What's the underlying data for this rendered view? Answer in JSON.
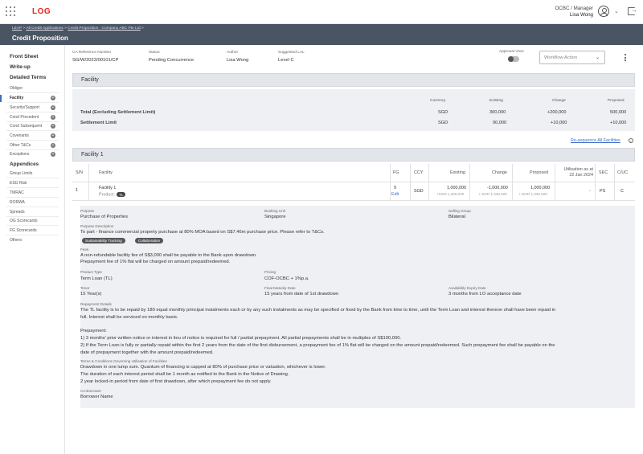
{
  "app": {
    "logo": "LOG",
    "user_role": "OCBC / Manager",
    "user_name": "Lisa Wong"
  },
  "breadcrumb": {
    "item1": "LEAP",
    "sep1": " > ",
    "item2": "All Credit Applications",
    "sep2": " > ",
    "item3": "Credit Proposition - Company ABC Pte Ltd",
    "sep3": " >"
  },
  "page_title": "Credit Proposition",
  "sidebar": {
    "front_sheet": "Front Sheet",
    "write_up": "Write-up",
    "detailed_terms": "Detailed Terms",
    "terms": [
      "Obligor",
      "Facility",
      "Security/Support",
      "Cond Precedent",
      "Cond Subsequent",
      "Covenants",
      "Other T&Cs",
      "Exceptions"
    ],
    "appendices": "Appendices",
    "appendix_items": [
      "Group Limits",
      "ESG Risk",
      "TMRAC",
      "RORWA",
      "Spreads",
      "OG Scorecards",
      "FG Scorecards",
      "Others"
    ]
  },
  "meta": {
    "ca_ref_label": "CA Reference Number",
    "ca_ref_value": "SG/W/2023/00101/CP",
    "status_label": "Status",
    "status_value": "Pending Concurrence",
    "author_label": "Author",
    "author_value": "Lisa Wong",
    "lal_label": "Suggested LAL",
    "lal_value": "Level C",
    "approval_view_label": "Approval View",
    "workflow_placeholder": "Workflow Action"
  },
  "facility_summary": {
    "section_title": "Facility",
    "headers": {
      "currency": "Currency",
      "existing": "Existing",
      "change": "Change",
      "proposed": "Proposed"
    },
    "rows": [
      {
        "label": "Total (Excluding Settlement Limit)",
        "currency": "SGD",
        "existing": "300,000",
        "change": "+200,000",
        "proposed": "500,000"
      },
      {
        "label": "Settlement Limit",
        "currency": "SGD",
        "existing": "90,000",
        "change": "+10,000",
        "proposed": "+10,000"
      }
    ]
  },
  "resequence_link": "Re-sequence All Facilities",
  "facility1": {
    "section_title": "Facility 1",
    "headers": {
      "sn": "S/N",
      "facility": "Facility",
      "fg": "FG",
      "ccy": "CCY",
      "existing": "Existing",
      "change": "Change",
      "proposed": "Proposed",
      "util_line1": "Utilisation as at",
      "util_line2": "22 Jan 2024",
      "sec": "SEC",
      "cuc": "C/UC"
    },
    "row": {
      "sn": "1",
      "facility_name": "Facility 1",
      "product_label": "Product:",
      "product_badge": "TL",
      "fg": "9",
      "edit": "Edit",
      "ccy": "SGD",
      "existing": "1,000,000",
      "existing_sub": "+SGD 1,330,020",
      "change": "-1,000,000",
      "change_sub": "+-SGD 1,330,020",
      "proposed": "1,000,000",
      "proposed_sub": "+-SGD 1,330,020",
      "utilisation": "-",
      "sec": "PS",
      "cuc": "C"
    }
  },
  "details": {
    "purpose_label": "Purpose",
    "purpose_value": "Purchase of Properties",
    "booking_unit_label": "Booking Unit",
    "booking_unit_value": "Singapore",
    "selling_group_label": "Selling Group",
    "selling_group_value": "Bilateral",
    "purpose_desc_label": "Purpose Description",
    "purpose_desc_value": "To part - finance commercial property purchase at 80% MOA based on S$7.46m purchase price. Please refer to T&Cs.",
    "tags": [
      "Sustainability Tracking",
      "Collaboration"
    ],
    "fees_label": "Fees",
    "fees_line1": "A non-refundable facility fee of S$3,000 shall be payable to the Bank upon drawdown.",
    "fees_line2": "Prepayment fee of 1% flat will be charged on amount prepaid/redeemed.",
    "product_type_label": "Product Type",
    "product_type_value": "Term Loan (TL)",
    "pricing_label": "Pricing",
    "pricing_value": "COF-OCBC + 1%p.a.",
    "tenor_label": "Tenor",
    "tenor_value": "15 Year(s)",
    "final_maturity_label": "Final Maturity Date",
    "final_maturity_value": "15 years from date of 1st drawdown",
    "availability_label": "Availability Expiry Date",
    "availability_value": "3 months from LO acceptance date",
    "repayment_label": "Repayment Details",
    "repayment_line1": "The TL facility is to be repaid by 180 equal monthly principal instalments each or by any such instalments as may be specified or fixed by the Bank from time to time, until the Term Loan and interest thereon shall have been repaid in",
    "repayment_line2": "full. Interest shall be serviced on monthly basis.",
    "prepayment_title": "Prepayment:",
    "prepayment_line1": "1) 3 months' prior written notice or interest in lieu of notice is required for full / partial prepayment. All partial prepayments shall be in multiples of S$100,000.",
    "prepayment_line2": "2) If the Term Loan is fully or partially repaid within the first 2 years from the date of the first disbursement, a prepayment fee of 1% flat will be charged on the amount prepaid/redeemed. Such prepayment fee shall be payable on the",
    "prepayment_line3": "date of prepayment together with the amount prepaid/redeemed.",
    "tnc_label": "Terms & Conditions Governing Utilisation of Facilities",
    "tnc_line1": "Drawdown in one lump sum. Quantum of financing is capped at 80% of purchase price or valuation, whichever is lower.",
    "tnc_line2": "The duration of each interest period shall be 1 month as notified to the Bank in the Notice of Drawing.",
    "tnc_line3": "2 year locked-in period from date of first drawdown, after which prepayment fee do not apply.",
    "co_borrower_label": "Co-Borrower",
    "co_borrower_value": "Borrower Name"
  }
}
